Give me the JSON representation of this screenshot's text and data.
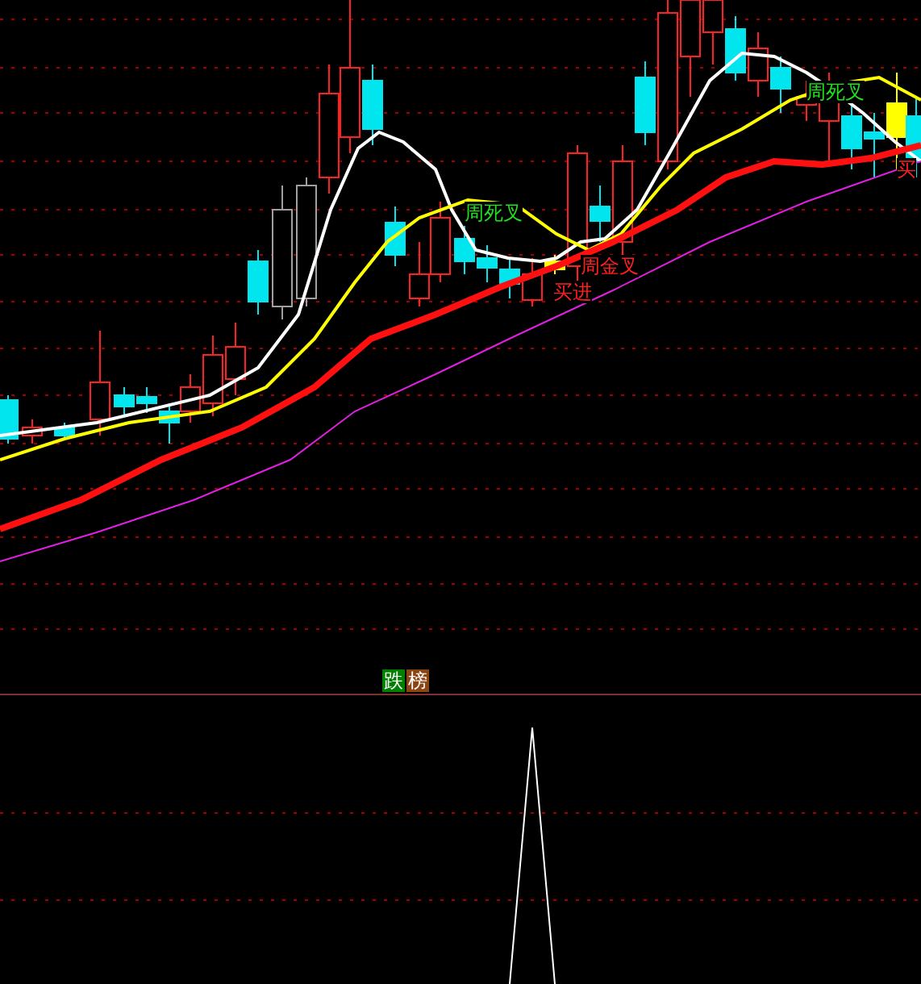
{
  "price_panel": {
    "signals": [
      {
        "text": "周死叉",
        "kind": "sell"
      },
      {
        "text": "周金叉",
        "kind": "buy"
      },
      {
        "text": "买进",
        "kind": "buy"
      },
      {
        "text": "周死叉",
        "kind": "sell"
      },
      {
        "text": "买",
        "kind": "buy"
      }
    ]
  },
  "indicator_panel": {
    "badges": [
      {
        "text": "跌",
        "color": "#008000"
      },
      {
        "text": "榜",
        "color": "#8b4513"
      }
    ]
  }
}
